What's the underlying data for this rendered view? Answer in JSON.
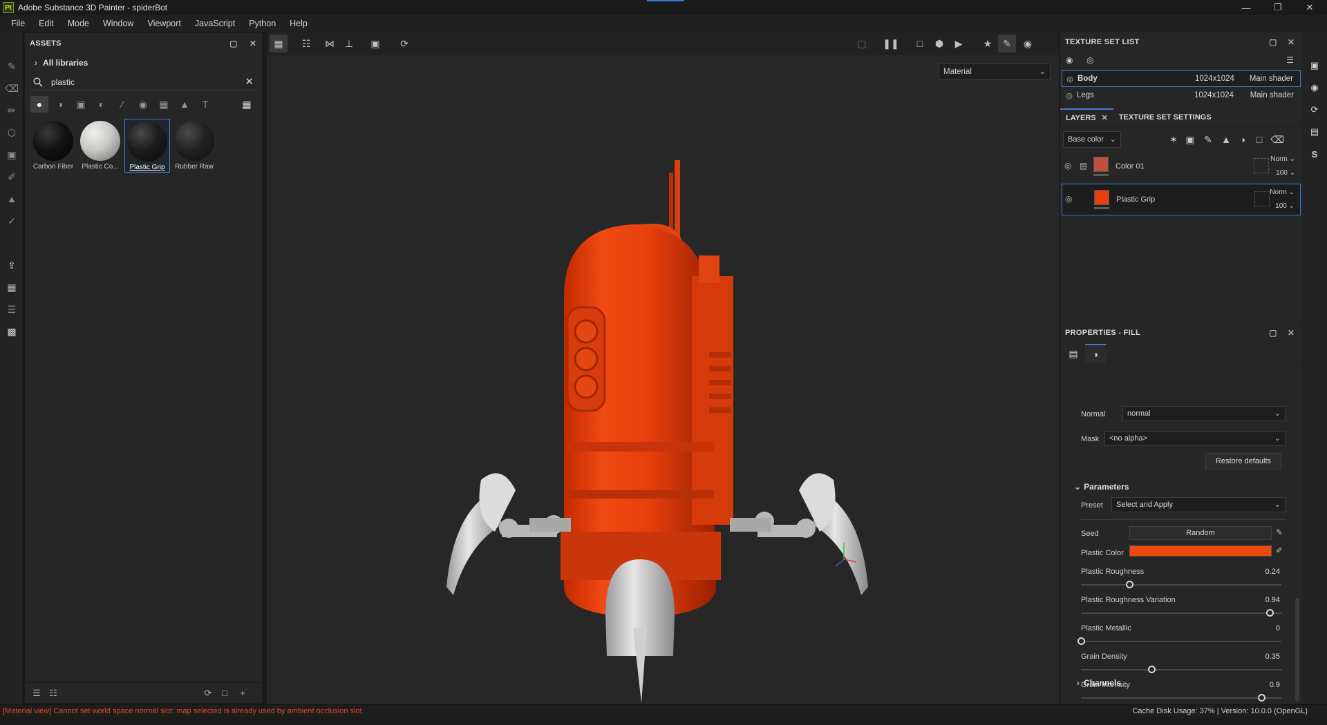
{
  "window": {
    "app_icon": "Pt",
    "title": "Adobe Substance 3D Painter - spiderBot"
  },
  "menu": [
    "File",
    "Edit",
    "Mode",
    "Window",
    "Viewport",
    "JavaScript",
    "Python",
    "Help"
  ],
  "assets": {
    "title": "ASSETS",
    "library": "All libraries",
    "search_value": "plastic",
    "items": [
      {
        "label": "Carbon Fiber",
        "selected": false
      },
      {
        "label": "Plastic Co...",
        "selected": false
      },
      {
        "label": "Plastic Grip",
        "selected": true
      },
      {
        "label": "Rubber Raw",
        "selected": false
      }
    ]
  },
  "viewport": {
    "display_mode": "Material"
  },
  "texture_set_list": {
    "title": "TEXTURE SET LIST",
    "rows": [
      {
        "name": "Body",
        "resolution": "1024x1024",
        "shader": "Main shader",
        "selected": true
      },
      {
        "name": "Legs",
        "resolution": "1024x1024",
        "shader": "Main shader",
        "selected": false
      }
    ]
  },
  "layers_panel": {
    "tabs": [
      "LAYERS",
      "TEXTURE SET SETTINGS"
    ],
    "channel": "Base color",
    "layers": [
      {
        "name": "Color 01",
        "blend": "Norm",
        "opacity": "100",
        "swatch": "#c0503c",
        "selected": false,
        "is_folder": true
      },
      {
        "name": "Plastic Grip",
        "blend": "Norm",
        "opacity": "100",
        "swatch": "#e8400c",
        "selected": true,
        "is_folder": false
      }
    ]
  },
  "properties": {
    "title": "PROPERTIES - FILL",
    "normal_label": "Normal",
    "normal_value": "normal",
    "mask_label": "Mask",
    "mask_value": "<no alpha>",
    "restore_label": "Restore defaults",
    "parameters_label": "Parameters",
    "preset_label": "Preset",
    "preset_value": "Select and Apply",
    "seed_label": "Seed",
    "seed_value": "Random",
    "plastic_color_label": "Plastic Color",
    "plastic_color": "#ee4a10",
    "sliders": [
      {
        "label": "Plastic Roughness",
        "value": "0.24",
        "fraction": 0.24
      },
      {
        "label": "Plastic Roughness Variation",
        "value": "0.94",
        "fraction": 0.94
      },
      {
        "label": "Plastic Metallic",
        "value": "0",
        "fraction": 0
      },
      {
        "label": "Grain Density",
        "value": "0.35",
        "fraction": 0.35
      },
      {
        "label": "Grain Intensity",
        "value": "0.9",
        "fraction": 0.9
      }
    ],
    "channels_label": "Channels"
  },
  "status": {
    "error": "[Material view] Cannot set world space normal slot: map selected is already used by ambient occlusion slot",
    "info": "Cache Disk Usage:   37% | Version: 10.0.0 (OpenGL)"
  }
}
